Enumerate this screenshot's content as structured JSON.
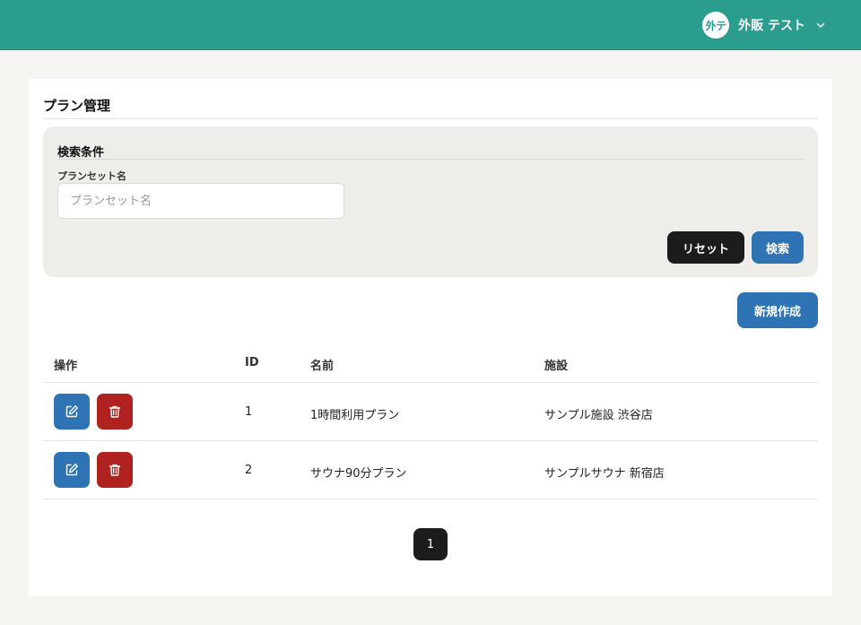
{
  "header": {
    "user": {
      "avatar_text": "外テ",
      "name": "外販 テスト",
      "chevron_icon": "chevron-down-icon"
    },
    "colors": {
      "bar": "#2a9d8f"
    }
  },
  "page": {
    "title": "プラン管理"
  },
  "search": {
    "title": "検索条件",
    "plan_set_label": "プランセット名",
    "plan_set_placeholder": "プランセット名",
    "plan_set_value": "",
    "reset_label": "リセット",
    "search_label": "検索"
  },
  "actions": {
    "new_label": "新規作成"
  },
  "table": {
    "headers": {
      "operation": "操作",
      "id": "ID",
      "name": "名前",
      "facility": "施設"
    },
    "rows": [
      {
        "id": "1",
        "name": "1時間利用プラン",
        "facility": "サンプル施設 渋谷店"
      },
      {
        "id": "2",
        "name": "サウナ90分プラン",
        "facility": "サンプルサウナ 新宿店"
      }
    ],
    "row_action_icons": [
      "edit-icon",
      "trash-icon"
    ]
  },
  "pagination": {
    "current": "1"
  },
  "colors": {
    "primary": "#2e74b5",
    "danger": "#b0221f",
    "dark": "#1c1c1c"
  }
}
